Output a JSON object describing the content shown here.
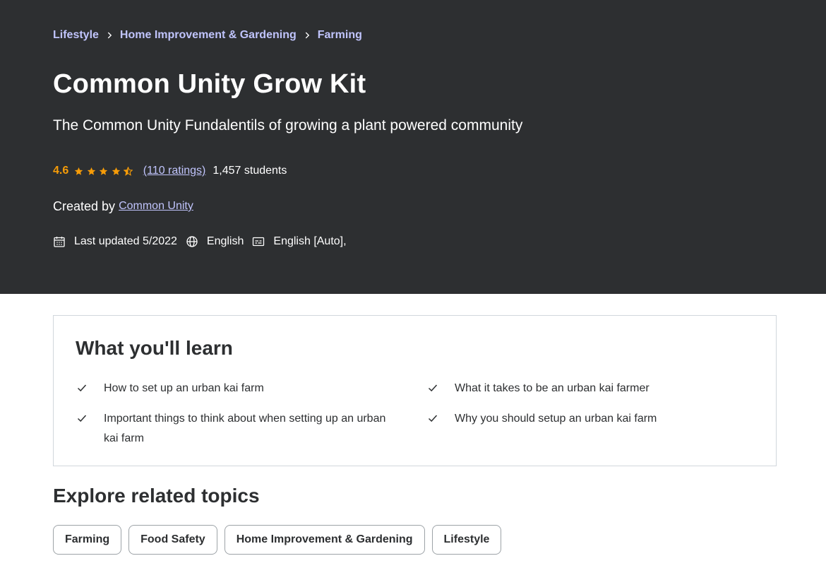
{
  "breadcrumb": [
    "Lifestyle",
    "Home Improvement & Gardening",
    "Farming"
  ],
  "course": {
    "title": "Common Unity Grow Kit",
    "subtitle": "The Common Unity Fundalentils of growing a plant powered community",
    "rating": "4.6",
    "stars": 4.5,
    "ratings_count": "(110 ratings)",
    "students": "1,457 students",
    "created_by_label": "Created by",
    "creator": "Common Unity",
    "last_updated": "Last updated 5/2022",
    "language": "English",
    "captions": "English [Auto],"
  },
  "learn": {
    "title": "What you'll learn",
    "items": [
      "How to set up an urban kai farm",
      "What it takes to be an urban kai farmer",
      "Important things to think about when setting up an urban kai farm",
      "Why you should setup an urban kai farm"
    ]
  },
  "explore": {
    "title": "Explore related topics",
    "topics": [
      "Farming",
      "Food Safety",
      "Home Improvement & Gardening",
      "Lifestyle"
    ]
  },
  "colors": {
    "hero_bg": "#2d2f31",
    "link": "#c0c4fc",
    "star": "#f69c08",
    "text": "#2d2f31"
  },
  "icons": [
    "chevron-right-icon",
    "star-icon",
    "star-half-icon",
    "calendar-icon",
    "globe-icon",
    "captions-icon",
    "check-icon"
  ]
}
